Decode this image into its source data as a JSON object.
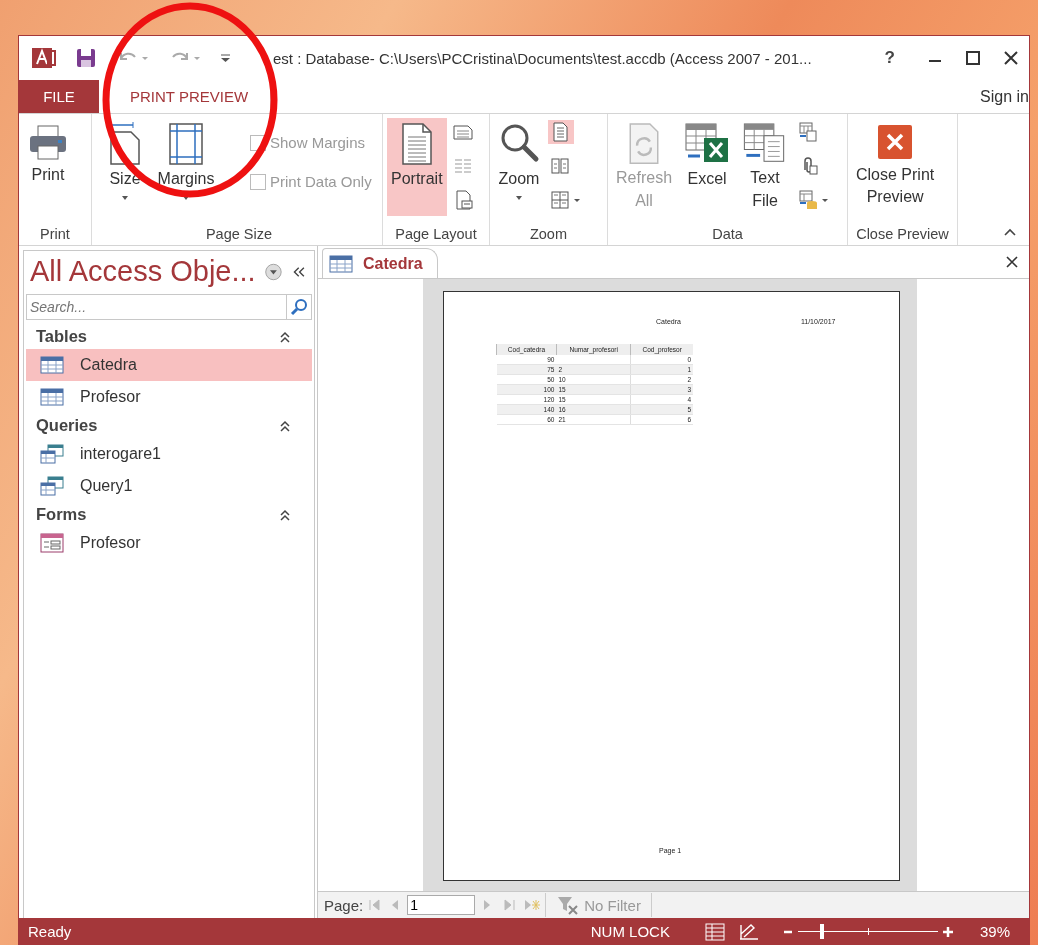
{
  "window": {
    "title": "est : Database- C:\\Users\\PCCristina\\Documents\\test.accdb (Access 2007 - 201...",
    "help": "?"
  },
  "ribbon_tabs": [
    {
      "label": "FILE",
      "kind": "file",
      "selected": false
    },
    {
      "label": "PRINT PREVIEW",
      "kind": "tab",
      "selected": true
    }
  ],
  "account": "Sign in",
  "ribbon_groups": [
    {
      "label": "Print",
      "commands": [
        {
          "kind": "large",
          "label": "Print",
          "dropdown": false,
          "disabled": false,
          "selected": false
        }
      ]
    },
    {
      "label": "Page Size",
      "commands": [
        {
          "kind": "large",
          "label": "Size",
          "dropdown": true,
          "disabled": false,
          "selected": false
        },
        {
          "kind": "large",
          "label": "Margins",
          "dropdown": true,
          "disabled": false,
          "selected": false
        },
        {
          "kind": "checks",
          "items": [
            {
              "label": "Show Margins",
              "checked": false,
              "disabled": true
            },
            {
              "label": "Print Data Only",
              "checked": false,
              "disabled": true
            }
          ]
        }
      ]
    },
    {
      "label": "Page Layout",
      "commands": [
        {
          "kind": "large",
          "label": "Portrait",
          "dropdown": false,
          "disabled": false,
          "selected": true
        },
        {
          "kind": "smalls",
          "items": [
            {
              "dropdown": false,
              "selected": false
            },
            {
              "dropdown": false,
              "selected": false
            },
            {
              "dropdown": false,
              "selected": false
            }
          ]
        }
      ]
    },
    {
      "label": "Zoom",
      "commands": [
        {
          "kind": "large",
          "label": "Zoom",
          "dropdown": true,
          "disabled": false,
          "selected": false
        },
        {
          "kind": "smalls",
          "items": [
            {
              "dropdown": false,
              "selected": true
            },
            {
              "dropdown": false,
              "selected": false
            },
            {
              "dropdown": true,
              "selected": false
            }
          ]
        }
      ]
    },
    {
      "label": "Data",
      "commands": [
        {
          "kind": "large",
          "label": "Refresh\nAll",
          "dropdown": false,
          "disabled": true,
          "selected": false
        },
        {
          "kind": "large",
          "label": "Excel",
          "dropdown": false,
          "disabled": false,
          "selected": false
        },
        {
          "kind": "large",
          "label": "Text\nFile",
          "dropdown": false,
          "disabled": false,
          "selected": false
        },
        {
          "kind": "smalls",
          "items": [
            {
              "dropdown": false,
              "selected": false
            },
            {
              "dropdown": false,
              "selected": false
            },
            {
              "dropdown": true,
              "selected": false
            }
          ]
        }
      ]
    },
    {
      "label": "Close Preview",
      "commands": [
        {
          "kind": "large",
          "label": "Close Print\nPreview",
          "dropdown": false,
          "disabled": false,
          "selected": false
        }
      ]
    }
  ],
  "nav_pane": {
    "title": "All Access Obje...",
    "search": {
      "placeholder": "Search..."
    },
    "groups": [
      {
        "label": "Tables",
        "kind": "table",
        "expanded": true,
        "items": [
          {
            "label": "Catedra",
            "selected": true
          },
          {
            "label": "Profesor",
            "selected": false
          }
        ]
      },
      {
        "label": "Queries",
        "kind": "query",
        "expanded": true,
        "items": [
          {
            "label": "interogare1",
            "selected": false
          },
          {
            "label": "Query1",
            "selected": false
          }
        ]
      },
      {
        "label": "Forms",
        "kind": "form",
        "expanded": true,
        "items": [
          {
            "label": "Profesor",
            "selected": false
          }
        ]
      }
    ]
  },
  "document_tabs": [
    {
      "label": "Catedra",
      "selected": true
    }
  ],
  "report": {
    "title": "Catedra",
    "date": "11/10/2017",
    "columns": [
      "Cod_catedra",
      "Numar_profesori",
      "Cod_profesor"
    ],
    "rows": [
      [
        "90",
        "",
        "0"
      ],
      [
        "75",
        "2",
        "1"
      ],
      [
        "50",
        "10",
        "2"
      ],
      [
        "100",
        "15",
        "3"
      ],
      [
        "120",
        "15",
        "4"
      ],
      [
        "140",
        "16",
        "5"
      ],
      [
        "60",
        "21",
        "6"
      ]
    ],
    "footer": "Page 1"
  },
  "page_navigation": {
    "label": "Page:",
    "value": "1",
    "filter": {
      "label": "No Filter",
      "disabled": true
    }
  },
  "status_bar": {
    "text": "Ready",
    "indicator": "NUM LOCK",
    "zoom": {
      "level": 0.16,
      "reading": "39%"
    }
  },
  "annotations": [
    {
      "kind": "circle"
    }
  ]
}
